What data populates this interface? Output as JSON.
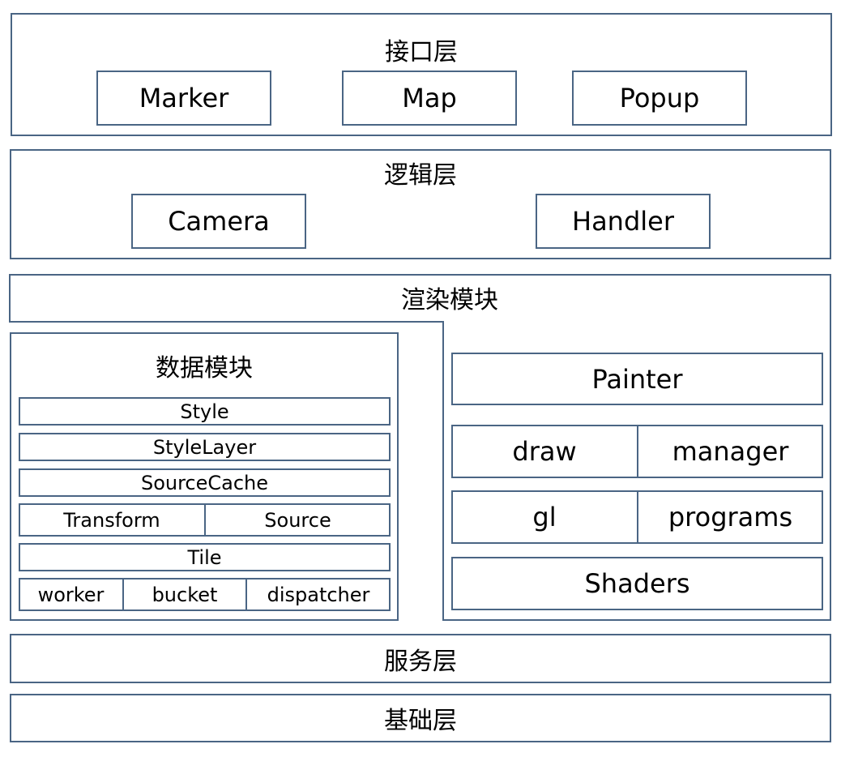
{
  "colors": {
    "border": "#4a6584",
    "background": "#ffffff",
    "text": "#000000"
  },
  "interface_layer": {
    "title": "接口层",
    "items": [
      "Marker",
      "Map",
      "Popup"
    ]
  },
  "logic_layer": {
    "title": "逻辑层",
    "items": [
      "Camera",
      "Handler"
    ]
  },
  "render_module": {
    "title": "渲染模块",
    "painter": "Painter",
    "row1": [
      "draw",
      "manager"
    ],
    "row2": [
      "gl",
      "programs"
    ],
    "shaders": "Shaders"
  },
  "data_module": {
    "title": "数据模块",
    "style": "Style",
    "style_layer": "StyleLayer",
    "source_cache": "SourceCache",
    "row_transform_source": [
      "Transform",
      "Source"
    ],
    "tile": "Tile",
    "row_worker": [
      "worker",
      "bucket",
      "dispatcher"
    ]
  },
  "service_layer": {
    "title": "服务层"
  },
  "base_layer": {
    "title": "基础层"
  }
}
